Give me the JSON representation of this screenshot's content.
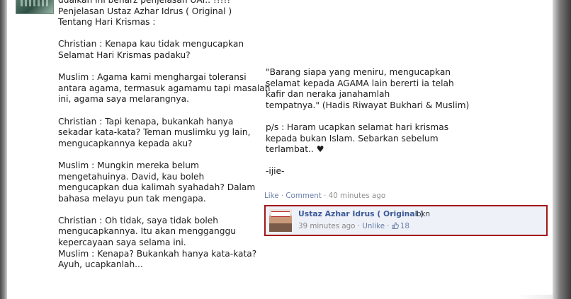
{
  "post": {
    "left_lines": [
      "dualkan ini benarz penjelasan UAI.. !!!!!",
      "Penjelasan Ustaz Azhar Idrus ( Original )",
      "Tentang Hari Krismas :",
      "",
      "Christian : Kenapa kau tidak mengucapkan",
      "Selamat Hari Krismas padaku?",
      "",
      "Muslim : Agama kami menghargai toleransi",
      "antara agama, termasuk agamamu tapi masalah",
      "ini, agama saya melarangnya.",
      "",
      "Christian : Tapi kenapa, bukankah hanya",
      "sekadar kata-kata? Teman muslimku yg lain,",
      "mengucapkannya kepada aku?",
      "",
      "Muslim : Mungkin mereka belum",
      "mengetahuinya. David, kau boleh",
      "mengucapkan dua kalimah syahadah? Dalam",
      "bahasa melayu pun tak mengapa.",
      "",
      "Christian : Oh tidak, saya tidak boleh",
      "mengucapkannya. Itu akan mengganggu",
      "kepercayaan saya selama ini.",
      "Muslim : Kenapa? Bukankah hanya kata-kata?",
      "Ayuh, ucapkanlah..."
    ],
    "right_lines": [
      "\"Barang siapa yang meniru, mengucapkan",
      "selamat kepada AGAMA lain bererti ia telah",
      "kafir dan neraka janahamlah",
      "tempatnya.\" (Hadis Riwayat Bukhari & Muslim)",
      "",
      "p/s : Haram ucapkan selamat hari krismas",
      "kepada bukan Islam. Sebarkan sebelum",
      "terlambat.. ♥",
      "",
      "-ijie-"
    ]
  },
  "actions": {
    "like": "Like",
    "separator": " · ",
    "comment": "Comment",
    "time": "40 minutes ago"
  },
  "comment": {
    "author": "Ustaz Azhar Idrus ( Original )",
    "text": "bkn",
    "time": "39 minutes ago",
    "separator": " · ",
    "unlike": "Unlike",
    "likes": "18",
    "avatar_icon": "profile-photo",
    "like_icon": "thumbs-up-icon"
  },
  "colors": {
    "link": "#3b5998",
    "highlight_border": "#a4161a"
  }
}
